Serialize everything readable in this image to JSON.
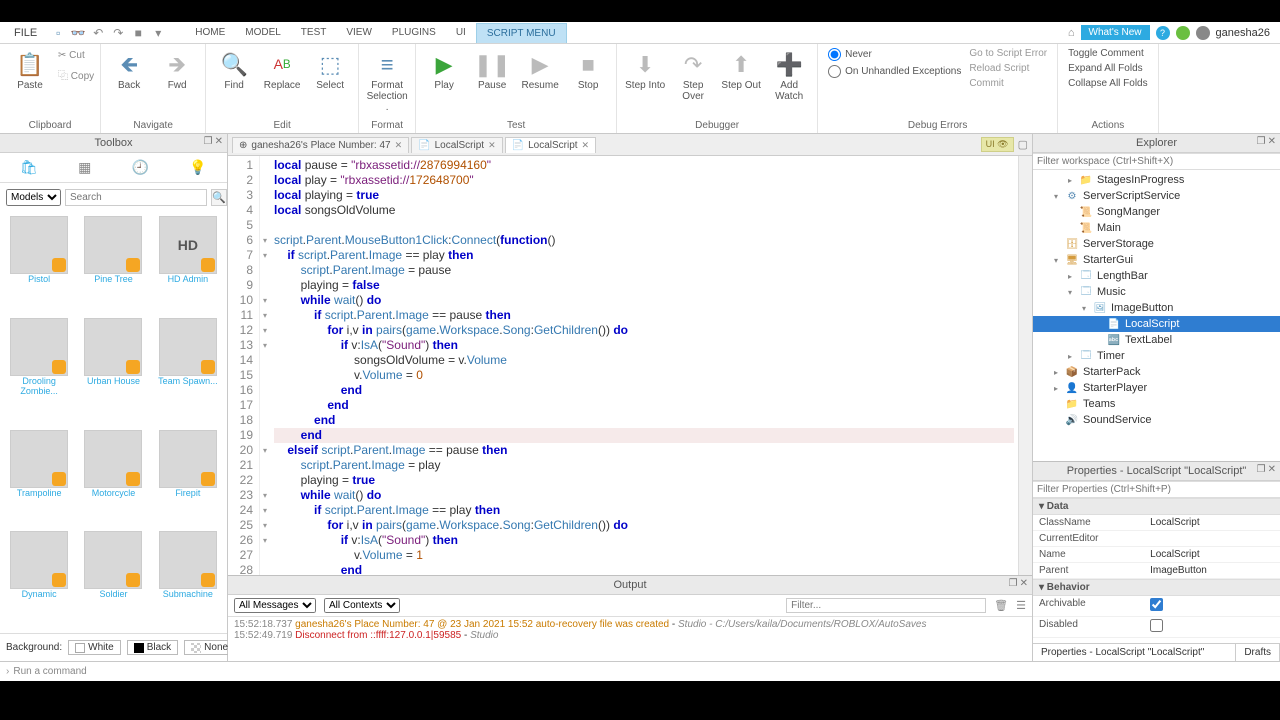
{
  "menu": {
    "file": "FILE"
  },
  "tabs": [
    "HOME",
    "MODEL",
    "TEST",
    "VIEW",
    "PLUGINS",
    "UI",
    "SCRIPT MENU"
  ],
  "active_tab": "SCRIPT MENU",
  "topright": {
    "whatsnew": "What's New",
    "user": "ganesha26"
  },
  "ribbon": {
    "clipboard": {
      "label": "Clipboard",
      "paste": "Paste",
      "cut": "Cut",
      "copy": "Copy"
    },
    "navigate": {
      "label": "Navigate",
      "back": "Back",
      "fwd": "Fwd"
    },
    "edit": {
      "label": "Edit",
      "find": "Find",
      "replace": "Replace",
      "select": "Select"
    },
    "format": {
      "label": "Format",
      "fmtsel": "Format Selection ."
    },
    "test": {
      "label": "Test",
      "play": "Play",
      "pause": "Pause",
      "resume": "Resume",
      "stop": "Stop"
    },
    "debugger": {
      "label": "Debugger",
      "into": "Step Into",
      "over": "Step Over",
      "out": "Step Out",
      "watch": "Add Watch"
    },
    "errors": {
      "label": "Debug Errors",
      "never": "Never",
      "unhandled": "On Unhandled Exceptions",
      "goto": "Go to Script Error",
      "reload": "Reload Script",
      "commit": "Commit"
    },
    "actions": {
      "label": "Actions",
      "toggle": "Toggle Comment",
      "expand": "Expand All Folds",
      "collapse": "Collapse All Folds"
    }
  },
  "toolbox": {
    "title": "Toolbox",
    "category": "Models",
    "search_ph": "Search",
    "bg_label": "Background:",
    "bg_white": "White",
    "bg_black": "Black",
    "bg_none": "None",
    "items": [
      {
        "name": "Pistol"
      },
      {
        "name": "Pine Tree"
      },
      {
        "name": "HD Admin"
      },
      {
        "name": "Drooling Zombie..."
      },
      {
        "name": "Urban House"
      },
      {
        "name": "Team Spawn..."
      },
      {
        "name": "Trampoline"
      },
      {
        "name": "Motorcycle"
      },
      {
        "name": "Firepit"
      },
      {
        "name": "Dynamic"
      },
      {
        "name": "Soldier"
      },
      {
        "name": "Submachine"
      }
    ]
  },
  "doctabs": [
    {
      "label": "ganesha26's Place Number: 47",
      "icon": "⊕"
    },
    {
      "label": "LocalScript",
      "icon": "📄"
    },
    {
      "label": "LocalScript",
      "icon": "📄",
      "active": true
    }
  ],
  "ui_indicator": "UI",
  "code_lines": [
    "local pause = \"rbxassetid://2876994160\"",
    "local play = \"rbxassetid://172648700\"",
    "local playing = true",
    "local songsOldVolume",
    "",
    "script.Parent.MouseButton1Click:Connect(function()",
    "    if script.Parent.Image == play then",
    "        script.Parent.Image = pause",
    "        playing = false",
    "        while wait() do",
    "            if script.Parent.Image == pause then",
    "                for i,v in pairs(game.Workspace.Song:GetChildren()) do",
    "                    if v:IsA(\"Sound\") then",
    "                        songsOldVolume = v.Volume",
    "                        v.Volume = 0",
    "                    end",
    "                end",
    "            end",
    "        end",
    "    elseif script.Parent.Image == pause then",
    "        script.Parent.Image = play",
    "        playing = true",
    "        while wait() do",
    "            if script.Parent.Image == play then",
    "                for i,v in pairs(game.Workspace.Song:GetChildren()) do",
    "                    if v:IsA(\"Sound\") then",
    "                        v.Volume = 1",
    "                    end"
  ],
  "output": {
    "title": "Output",
    "all_msgs": "All Messages",
    "all_ctx": "All Contexts",
    "filter_ph": "Filter...",
    "lines": [
      {
        "ts": "15:52:18.737",
        "msg": "ganesha26's Place Number: 47 @ 23 Jan 2021 15:52 auto-recovery file was created",
        "kind": "warn",
        "loc": "Studio - C:/Users/kaila/Documents/ROBLOX/AutoSaves"
      },
      {
        "ts": "15:52:49.719",
        "msg": "Disconnect from ::ffff:127.0.0.1|59585",
        "kind": "err",
        "loc": "Studio"
      }
    ]
  },
  "explorer": {
    "title": "Explorer",
    "filter_ph": "Filter workspace (Ctrl+Shift+X)",
    "nodes": [
      {
        "indent": 2,
        "arrow": "▸",
        "icon": "📁",
        "color": "#e8b84e",
        "label": "StagesInProgress"
      },
      {
        "indent": 1,
        "arrow": "▾",
        "icon": "⚙",
        "color": "#5b8db5",
        "label": "ServerScriptService"
      },
      {
        "indent": 2,
        "arrow": "",
        "icon": "📜",
        "color": "#5b8db5",
        "label": "SongManger"
      },
      {
        "indent": 2,
        "arrow": "",
        "icon": "📜",
        "color": "#5b8db5",
        "label": "Main"
      },
      {
        "indent": 1,
        "arrow": "",
        "icon": "🗄",
        "color": "#d49b3e",
        "label": "ServerStorage"
      },
      {
        "indent": 1,
        "arrow": "▾",
        "icon": "🖥",
        "color": "#d49b3e",
        "label": "StarterGui"
      },
      {
        "indent": 2,
        "arrow": "▸",
        "icon": "🗔",
        "color": "#6aa5c8",
        "label": "LengthBar"
      },
      {
        "indent": 2,
        "arrow": "▾",
        "icon": "🗔",
        "color": "#6aa5c8",
        "label": "Music"
      },
      {
        "indent": 3,
        "arrow": "▾",
        "icon": "🖼",
        "color": "#6aa5c8",
        "label": "ImageButton"
      },
      {
        "indent": 4,
        "arrow": "",
        "icon": "📄",
        "color": "#5b8db5",
        "label": "LocalScript",
        "selected": true
      },
      {
        "indent": 4,
        "arrow": "",
        "icon": "🔤",
        "color": "#6aa5c8",
        "label": "TextLabel"
      },
      {
        "indent": 2,
        "arrow": "▸",
        "icon": "🗔",
        "color": "#6aa5c8",
        "label": "Timer"
      },
      {
        "indent": 1,
        "arrow": "▸",
        "icon": "📦",
        "color": "#d49b3e",
        "label": "StarterPack"
      },
      {
        "indent": 1,
        "arrow": "▸",
        "icon": "👤",
        "color": "#d49b3e",
        "label": "StarterPlayer"
      },
      {
        "indent": 1,
        "arrow": "",
        "icon": "📁",
        "color": "#e8b84e",
        "label": "Teams"
      },
      {
        "indent": 1,
        "arrow": "",
        "icon": "🔊",
        "color": "#d49b3e",
        "label": "SoundService"
      }
    ]
  },
  "properties": {
    "title": "Properties - LocalScript \"LocalScript\"",
    "filter_ph": "Filter Properties (Ctrl+Shift+P)",
    "sections": [
      {
        "name": "Data",
        "rows": [
          {
            "k": "ClassName",
            "v": "LocalScript"
          },
          {
            "k": "CurrentEditor",
            "v": ""
          },
          {
            "k": "Name",
            "v": "LocalScript"
          },
          {
            "k": "Parent",
            "v": "ImageButton"
          }
        ]
      },
      {
        "name": "Behavior",
        "rows": [
          {
            "k": "Archivable",
            "v": "[x]"
          },
          {
            "k": "Disabled",
            "v": "[ ]"
          }
        ]
      }
    ],
    "drafts_tab1": "Properties - LocalScript \"LocalScript\"",
    "drafts_tab2": "Drafts"
  },
  "cmdbar": "Run a command"
}
